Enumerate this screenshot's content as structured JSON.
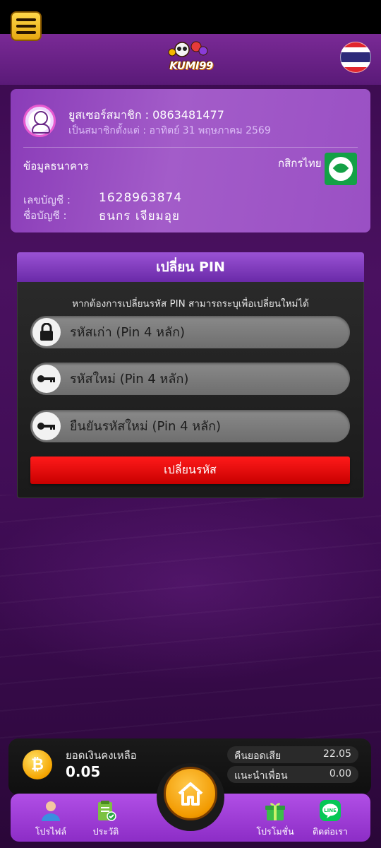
{
  "header": {
    "logo_text": "KUMI99",
    "menu_icon": "hamburger-menu-icon",
    "language_icon": "thai-flag-icon"
  },
  "profile": {
    "user_line": "ยูสเซอร์สมาชิก : 0863481477",
    "since_line": "เป็นสมาชิกตั้งแต่ : อาทิตย์ 31 พฤษภาคม 2569",
    "bank_section_title": "ข้อมูลธนาคาร",
    "bank_name": "กสิกรไทย",
    "account_number_label": "เลขบัญชี :",
    "account_number": "1628963874",
    "account_name_label": "ชื่อบัญชี :",
    "account_name": "ธนกร เจียมอุย"
  },
  "pin_form": {
    "title": "เปลี่ยน PIN",
    "hint": "หากต้องการเปลี่ยนรหัส PIN สามารถระบุเพื่อเปลี่ยนใหม่ได้",
    "old_pin_placeholder": "รหัสเก่า (Pin 4 หลัก)",
    "new_pin_placeholder": "รหัสใหม่ (Pin 4 หลัก)",
    "confirm_pin_placeholder": "ยืนยันรหัสใหม่ (Pin 4 หลัก)",
    "submit_label": "เปลี่ยนรหัส"
  },
  "balance": {
    "label": "ยอดเงินคงเหลือ",
    "value": "0.05",
    "cashback_label": "คืนยอดเสีย",
    "cashback_value": "22.05",
    "referral_label": "แนะนำเพื่อน",
    "referral_value": "0.00"
  },
  "nav": {
    "profile_label": "โปรไฟล์",
    "history_label": "ประวัติ",
    "promotion_label": "โปรโมชั่น",
    "contact_label": "ติดต่อเรา"
  },
  "colors": {
    "header": "#7a2a96",
    "card": "#9a50c4",
    "submit": "#e00000",
    "nav": "#a040d8",
    "home": "#f5a400"
  }
}
